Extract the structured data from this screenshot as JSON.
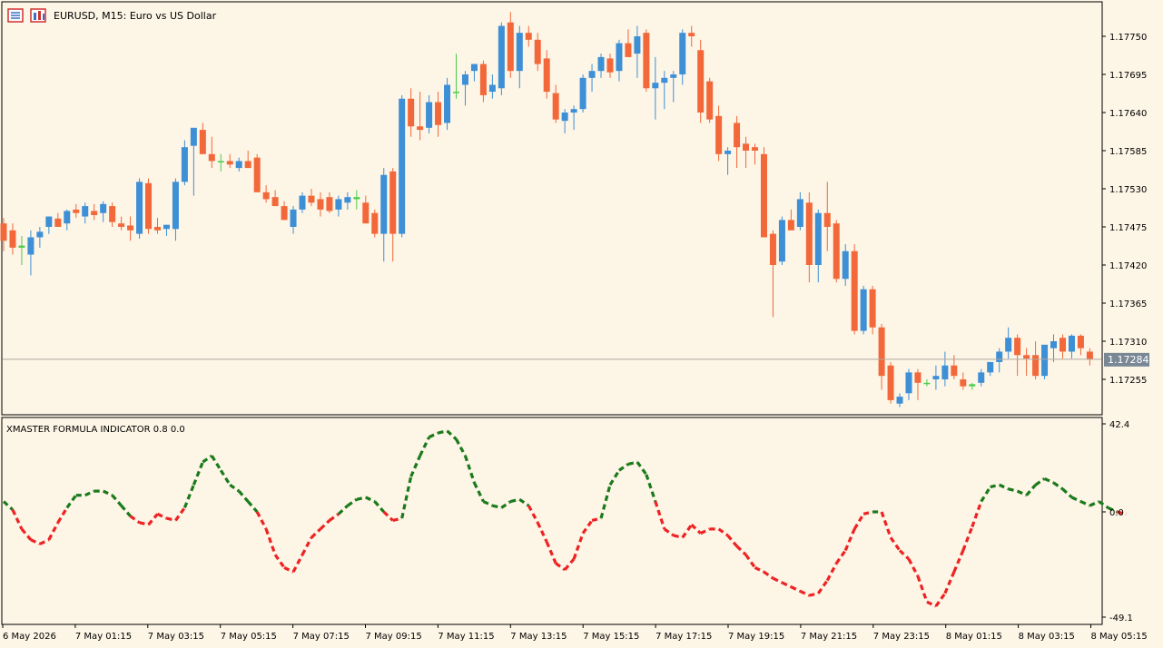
{
  "header": {
    "symbol_title": "EURUSD, M15:  Euro vs US Dollar",
    "icons": [
      "toolbar-list-icon",
      "chart-window-icon"
    ]
  },
  "indicator": {
    "label": "XMASTER FORMULA INDICATOR 0.8 0.0"
  },
  "colors": {
    "background": "#fdf5e6",
    "bull": "#3d8fd6",
    "bear": "#f2683a",
    "doji": "#4ccc4c",
    "signal_up": "#1a7a1a",
    "signal_down": "#ee2222",
    "price_line": "#b0a8a0",
    "price_tag": "#7a8896"
  },
  "price_axis": {
    "ticks": [
      "1.17750",
      "1.17695",
      "1.17640",
      "1.17585",
      "1.17530",
      "1.17475",
      "1.17420",
      "1.17365",
      "1.17310",
      "1.17255"
    ],
    "current_price": "1.17284"
  },
  "indicator_axis": {
    "ticks": [
      "42.4",
      "0.0",
      "-49.1"
    ]
  },
  "time_axis": {
    "ticks": [
      "6 May 2026",
      "7 May 01:15",
      "7 May 03:15",
      "7 May 05:15",
      "7 May 07:15",
      "7 May 09:15",
      "7 May 11:15",
      "7 May 13:15",
      "7 May 15:15",
      "7 May 17:15",
      "7 May 19:15",
      "7 May 21:15",
      "7 May 23:15",
      "8 May 01:15",
      "8 May 03:15",
      "8 May 05:15"
    ]
  },
  "chart_data": [
    {
      "type": "candlestick",
      "title": "EURUSD, M15:  Euro vs US Dollar",
      "ylim": [
        1.1722,
        1.1781
      ],
      "candles": [
        {
          "o": 1.1748,
          "h": 1.17488,
          "l": 1.1744,
          "c": 1.17455
        },
        {
          "o": 1.1747,
          "h": 1.1748,
          "l": 1.17435,
          "c": 1.17445
        },
        {
          "o": 1.17445,
          "h": 1.17462,
          "l": 1.1742,
          "c": 1.17448
        },
        {
          "o": 1.17435,
          "h": 1.1747,
          "l": 1.17405,
          "c": 1.1746
        },
        {
          "o": 1.1746,
          "h": 1.17475,
          "l": 1.17445,
          "c": 1.17468
        },
        {
          "o": 1.17475,
          "h": 1.17485,
          "l": 1.17465,
          "c": 1.1749
        },
        {
          "o": 1.17487,
          "h": 1.17495,
          "l": 1.17478,
          "c": 1.17475
        },
        {
          "o": 1.1748,
          "h": 1.175,
          "l": 1.1747,
          "c": 1.17498
        },
        {
          "o": 1.175,
          "h": 1.17508,
          "l": 1.17488,
          "c": 1.17495
        },
        {
          "o": 1.1749,
          "h": 1.1751,
          "l": 1.1748,
          "c": 1.17505
        },
        {
          "o": 1.17498,
          "h": 1.17508,
          "l": 1.17485,
          "c": 1.17492
        },
        {
          "o": 1.17495,
          "h": 1.17512,
          "l": 1.17482,
          "c": 1.17508
        },
        {
          "o": 1.17505,
          "h": 1.1751,
          "l": 1.17475,
          "c": 1.17482
        },
        {
          "o": 1.1748,
          "h": 1.1749,
          "l": 1.1747,
          "c": 1.17475
        },
        {
          "o": 1.17477,
          "h": 1.1749,
          "l": 1.17455,
          "c": 1.1747
        },
        {
          "o": 1.17465,
          "h": 1.17545,
          "l": 1.17458,
          "c": 1.1754
        },
        {
          "o": 1.17538,
          "h": 1.17545,
          "l": 1.17465,
          "c": 1.17472
        },
        {
          "o": 1.17475,
          "h": 1.17488,
          "l": 1.17465,
          "c": 1.1747
        },
        {
          "o": 1.17472,
          "h": 1.17478,
          "l": 1.17462,
          "c": 1.17478
        },
        {
          "o": 1.17472,
          "h": 1.17545,
          "l": 1.17455,
          "c": 1.1754
        },
        {
          "o": 1.1754,
          "h": 1.176,
          "l": 1.17535,
          "c": 1.1759
        },
        {
          "o": 1.17592,
          "h": 1.17605,
          "l": 1.1752,
          "c": 1.17618
        },
        {
          "o": 1.17615,
          "h": 1.17625,
          "l": 1.1758,
          "c": 1.1758
        },
        {
          "o": 1.1758,
          "h": 1.17605,
          "l": 1.1756,
          "c": 1.1757
        },
        {
          "o": 1.1757,
          "h": 1.1758,
          "l": 1.17555,
          "c": 1.1757
        },
        {
          "o": 1.1757,
          "h": 1.1758,
          "l": 1.1756,
          "c": 1.17565
        },
        {
          "o": 1.1756,
          "h": 1.17575,
          "l": 1.17555,
          "c": 1.1757
        },
        {
          "o": 1.1757,
          "h": 1.17585,
          "l": 1.1756,
          "c": 1.1756
        },
        {
          "o": 1.17575,
          "h": 1.1758,
          "l": 1.17525,
          "c": 1.17525
        },
        {
          "o": 1.17525,
          "h": 1.17535,
          "l": 1.1751,
          "c": 1.17515
        },
        {
          "o": 1.17518,
          "h": 1.17528,
          "l": 1.17505,
          "c": 1.17505
        },
        {
          "o": 1.17505,
          "h": 1.17512,
          "l": 1.17485,
          "c": 1.17485
        },
        {
          "o": 1.17475,
          "h": 1.17505,
          "l": 1.17465,
          "c": 1.175
        },
        {
          "o": 1.175,
          "h": 1.17525,
          "l": 1.17495,
          "c": 1.1752
        },
        {
          "o": 1.1752,
          "h": 1.1753,
          "l": 1.17505,
          "c": 1.1751
        },
        {
          "o": 1.17515,
          "h": 1.17525,
          "l": 1.1749,
          "c": 1.175
        },
        {
          "o": 1.17518,
          "h": 1.17525,
          "l": 1.17495,
          "c": 1.17498
        },
        {
          "o": 1.175,
          "h": 1.1752,
          "l": 1.1749,
          "c": 1.17515
        },
        {
          "o": 1.1751,
          "h": 1.17525,
          "l": 1.175,
          "c": 1.17518
        },
        {
          "o": 1.17518,
          "h": 1.17528,
          "l": 1.175,
          "c": 1.17515
        },
        {
          "o": 1.1751,
          "h": 1.1752,
          "l": 1.1748,
          "c": 1.1748
        },
        {
          "o": 1.17495,
          "h": 1.175,
          "l": 1.1746,
          "c": 1.17465
        },
        {
          "o": 1.17465,
          "h": 1.1756,
          "l": 1.17425,
          "c": 1.1755
        },
        {
          "o": 1.17555,
          "h": 1.1756,
          "l": 1.17425,
          "c": 1.17465
        },
        {
          "o": 1.17465,
          "h": 1.17665,
          "l": 1.1746,
          "c": 1.1766
        },
        {
          "o": 1.1766,
          "h": 1.17675,
          "l": 1.17605,
          "c": 1.1762
        },
        {
          "o": 1.1762,
          "h": 1.1767,
          "l": 1.176,
          "c": 1.17615
        },
        {
          "o": 1.17618,
          "h": 1.17665,
          "l": 1.1761,
          "c": 1.17655
        },
        {
          "o": 1.17655,
          "h": 1.1767,
          "l": 1.17605,
          "c": 1.17622
        },
        {
          "o": 1.17625,
          "h": 1.1769,
          "l": 1.17615,
          "c": 1.1768
        },
        {
          "o": 1.1767,
          "h": 1.17725,
          "l": 1.1766,
          "c": 1.1767
        },
        {
          "o": 1.1768,
          "h": 1.177,
          "l": 1.1765,
          "c": 1.17695
        },
        {
          "o": 1.177,
          "h": 1.1771,
          "l": 1.17685,
          "c": 1.1771
        },
        {
          "o": 1.1771,
          "h": 1.17715,
          "l": 1.17655,
          "c": 1.17665
        },
        {
          "o": 1.1767,
          "h": 1.17695,
          "l": 1.1766,
          "c": 1.1768
        },
        {
          "o": 1.17675,
          "h": 1.1777,
          "l": 1.17665,
          "c": 1.17765
        },
        {
          "o": 1.1777,
          "h": 1.17785,
          "l": 1.1769,
          "c": 1.177
        },
        {
          "o": 1.177,
          "h": 1.17765,
          "l": 1.17675,
          "c": 1.17755
        },
        {
          "o": 1.17755,
          "h": 1.17765,
          "l": 1.17735,
          "c": 1.17745
        },
        {
          "o": 1.17745,
          "h": 1.17755,
          "l": 1.177,
          "c": 1.1771
        },
        {
          "o": 1.17718,
          "h": 1.1773,
          "l": 1.1766,
          "c": 1.1767
        },
        {
          "o": 1.17668,
          "h": 1.1768,
          "l": 1.17625,
          "c": 1.1763
        },
        {
          "o": 1.17628,
          "h": 1.17645,
          "l": 1.1761,
          "c": 1.1764
        },
        {
          "o": 1.1764,
          "h": 1.1765,
          "l": 1.17615,
          "c": 1.17645
        },
        {
          "o": 1.17645,
          "h": 1.17695,
          "l": 1.1764,
          "c": 1.1769
        },
        {
          "o": 1.1769,
          "h": 1.1771,
          "l": 1.1767,
          "c": 1.177
        },
        {
          "o": 1.177,
          "h": 1.17725,
          "l": 1.1769,
          "c": 1.1772
        },
        {
          "o": 1.17718,
          "h": 1.17725,
          "l": 1.1769,
          "c": 1.17698
        },
        {
          "o": 1.177,
          "h": 1.17745,
          "l": 1.17685,
          "c": 1.1774
        },
        {
          "o": 1.1774,
          "h": 1.1776,
          "l": 1.1772,
          "c": 1.1772
        },
        {
          "o": 1.17725,
          "h": 1.17765,
          "l": 1.1769,
          "c": 1.1775
        },
        {
          "o": 1.17755,
          "h": 1.1776,
          "l": 1.1767,
          "c": 1.17675
        },
        {
          "o": 1.17675,
          "h": 1.1772,
          "l": 1.1763,
          "c": 1.17683
        },
        {
          "o": 1.17683,
          "h": 1.177,
          "l": 1.17645,
          "c": 1.1769
        },
        {
          "o": 1.1769,
          "h": 1.177,
          "l": 1.17655,
          "c": 1.17695
        },
        {
          "o": 1.17695,
          "h": 1.1776,
          "l": 1.1768,
          "c": 1.17755
        },
        {
          "o": 1.17755,
          "h": 1.17765,
          "l": 1.17735,
          "c": 1.1775
        },
        {
          "o": 1.1773,
          "h": 1.17745,
          "l": 1.17625,
          "c": 1.1764
        },
        {
          "o": 1.17685,
          "h": 1.1769,
          "l": 1.17625,
          "c": 1.1763
        },
        {
          "o": 1.17635,
          "h": 1.1765,
          "l": 1.1757,
          "c": 1.1758
        },
        {
          "o": 1.1758,
          "h": 1.1759,
          "l": 1.1755,
          "c": 1.17585
        },
        {
          "o": 1.17625,
          "h": 1.17635,
          "l": 1.1756,
          "c": 1.1759
        },
        {
          "o": 1.17595,
          "h": 1.17605,
          "l": 1.1756,
          "c": 1.17585
        },
        {
          "o": 1.1759,
          "h": 1.17595,
          "l": 1.17565,
          "c": 1.17585
        },
        {
          "o": 1.1758,
          "h": 1.1759,
          "l": 1.1746,
          "c": 1.1746
        },
        {
          "o": 1.17465,
          "h": 1.1747,
          "l": 1.17345,
          "c": 1.1742
        },
        {
          "o": 1.17425,
          "h": 1.1749,
          "l": 1.1742,
          "c": 1.17485
        },
        {
          "o": 1.17485,
          "h": 1.175,
          "l": 1.17475,
          "c": 1.1747
        },
        {
          "o": 1.17475,
          "h": 1.17525,
          "l": 1.1747,
          "c": 1.17515
        },
        {
          "o": 1.1751,
          "h": 1.17525,
          "l": 1.17395,
          "c": 1.1742
        },
        {
          "o": 1.1742,
          "h": 1.175,
          "l": 1.17395,
          "c": 1.17495
        },
        {
          "o": 1.17495,
          "h": 1.1754,
          "l": 1.1744,
          "c": 1.17475
        },
        {
          "o": 1.1748,
          "h": 1.17485,
          "l": 1.17395,
          "c": 1.174
        },
        {
          "o": 1.174,
          "h": 1.1745,
          "l": 1.1739,
          "c": 1.1744
        },
        {
          "o": 1.1744,
          "h": 1.1745,
          "l": 1.1732,
          "c": 1.17325
        },
        {
          "o": 1.17325,
          "h": 1.1739,
          "l": 1.1732,
          "c": 1.17385
        },
        {
          "o": 1.17385,
          "h": 1.1739,
          "l": 1.1732,
          "c": 1.1733
        },
        {
          "o": 1.1733,
          "h": 1.17335,
          "l": 1.1724,
          "c": 1.1726
        },
        {
          "o": 1.17275,
          "h": 1.1728,
          "l": 1.1722,
          "c": 1.17225
        },
        {
          "o": 1.1722,
          "h": 1.17235,
          "l": 1.17215,
          "c": 1.1723
        },
        {
          "o": 1.17235,
          "h": 1.1727,
          "l": 1.17225,
          "c": 1.17265
        },
        {
          "o": 1.17265,
          "h": 1.1727,
          "l": 1.17225,
          "c": 1.1725
        },
        {
          "o": 1.1725,
          "h": 1.17255,
          "l": 1.17245,
          "c": 1.1725
        },
        {
          "o": 1.17255,
          "h": 1.17275,
          "l": 1.1724,
          "c": 1.1726
        },
        {
          "o": 1.17255,
          "h": 1.17295,
          "l": 1.17245,
          "c": 1.17275
        },
        {
          "o": 1.17275,
          "h": 1.1729,
          "l": 1.17255,
          "c": 1.1726
        },
        {
          "o": 1.17255,
          "h": 1.17265,
          "l": 1.1724,
          "c": 1.17245
        },
        {
          "o": 1.17245,
          "h": 1.1725,
          "l": 1.1724,
          "c": 1.17248
        },
        {
          "o": 1.1725,
          "h": 1.1727,
          "l": 1.17245,
          "c": 1.17265
        },
        {
          "o": 1.17265,
          "h": 1.1728,
          "l": 1.1726,
          "c": 1.1728
        },
        {
          "o": 1.1728,
          "h": 1.173,
          "l": 1.17265,
          "c": 1.17295
        },
        {
          "o": 1.17295,
          "h": 1.1733,
          "l": 1.17285,
          "c": 1.17315
        },
        {
          "o": 1.17315,
          "h": 1.1732,
          "l": 1.1726,
          "c": 1.1729
        },
        {
          "o": 1.1729,
          "h": 1.173,
          "l": 1.1726,
          "c": 1.17285
        },
        {
          "o": 1.1729,
          "h": 1.1731,
          "l": 1.17255,
          "c": 1.1726
        },
        {
          "o": 1.1726,
          "h": 1.173,
          "l": 1.17255,
          "c": 1.17305
        },
        {
          "o": 1.173,
          "h": 1.1732,
          "l": 1.1728,
          "c": 1.1731
        },
        {
          "o": 1.17315,
          "h": 1.1732,
          "l": 1.17285,
          "c": 1.17295
        },
        {
          "o": 1.17295,
          "h": 1.1732,
          "l": 1.17285,
          "c": 1.17318
        },
        {
          "o": 1.17318,
          "h": 1.1732,
          "l": 1.1729,
          "c": 1.173
        },
        {
          "o": 1.17295,
          "h": 1.173,
          "l": 1.17275,
          "c": 1.17284
        }
      ]
    },
    {
      "type": "line",
      "title": "XMASTER FORMULA INDICATOR 0.8 0.0",
      "ylim": [
        -49.1,
        42.4
      ],
      "series": [
        {
          "values": [
            5,
            1,
            -8,
            -13,
            -15,
            -13,
            -5,
            2,
            8,
            8,
            10,
            10,
            8,
            3,
            -2,
            -5,
            -6,
            -1,
            -3,
            -4,
            2,
            13,
            24,
            27,
            20,
            13,
            10,
            5,
            0,
            -8,
            -20,
            -26,
            -28,
            -20,
            -12,
            -8,
            -4,
            -1,
            3,
            6,
            7,
            5,
            0,
            -4,
            -3,
            17,
            27,
            36,
            38,
            39,
            35,
            27,
            14,
            5,
            3,
            2,
            5,
            6,
            3,
            -5,
            -14,
            -24,
            -27,
            -22,
            -10,
            -4,
            -3,
            13,
            20,
            23,
            24,
            18,
            5,
            -8,
            -11,
            -12,
            -6,
            -10,
            -8,
            -8,
            -11,
            -16,
            -20,
            -26,
            -28,
            -31,
            -33,
            -35,
            -37,
            -39,
            -38,
            -32,
            -24,
            -18,
            -8,
            -1,
            0,
            0,
            -12,
            -18,
            -22,
            -30,
            -42,
            -44,
            -38,
            -28,
            -18,
            -7,
            5,
            12,
            13,
            11,
            10,
            8,
            13,
            16,
            14,
            11,
            7,
            5,
            3,
            5,
            2,
            0,
            -1
          ]
        }
      ]
    }
  ]
}
